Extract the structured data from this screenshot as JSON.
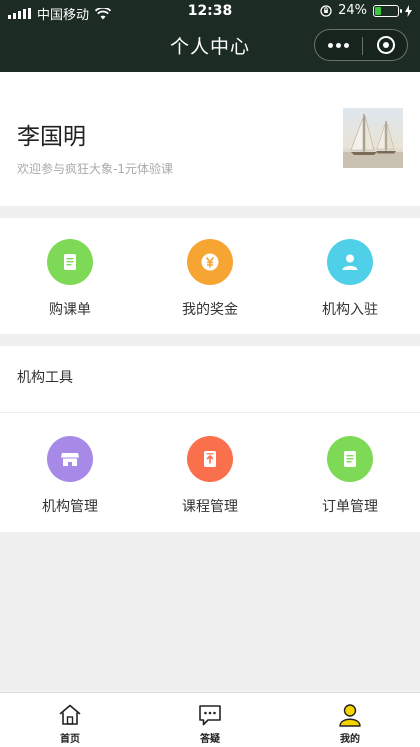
{
  "status_bar": {
    "carrier": "中国移动",
    "time": "12:38",
    "battery": "24%"
  },
  "nav": {
    "title": "个人中心"
  },
  "profile": {
    "name": "李国明",
    "welcome": "欢迎参与疯狂大象-1元体验课"
  },
  "quick_menu": [
    {
      "label": "购课单",
      "icon": "document-icon",
      "color": "#7ed957"
    },
    {
      "label": "我的奖金",
      "icon": "yen-coin-icon",
      "color": "#f7a532"
    },
    {
      "label": "机构入驻",
      "icon": "person-icon",
      "color": "#4fd0e8"
    }
  ],
  "tools": {
    "title": "机构工具",
    "items": [
      {
        "label": "机构管理",
        "icon": "storefront-icon",
        "color": "#a78ae8"
      },
      {
        "label": "课程管理",
        "icon": "upload-document-icon",
        "color": "#fa6f4c"
      },
      {
        "label": "订单管理",
        "icon": "list-document-icon",
        "color": "#7ed957"
      }
    ]
  },
  "tabbar": [
    {
      "label": "首页",
      "icon": "home-icon"
    },
    {
      "label": "答疑",
      "icon": "chat-bubble-icon"
    },
    {
      "label": "我的",
      "icon": "user-icon",
      "active_color": "#f5d300"
    }
  ]
}
